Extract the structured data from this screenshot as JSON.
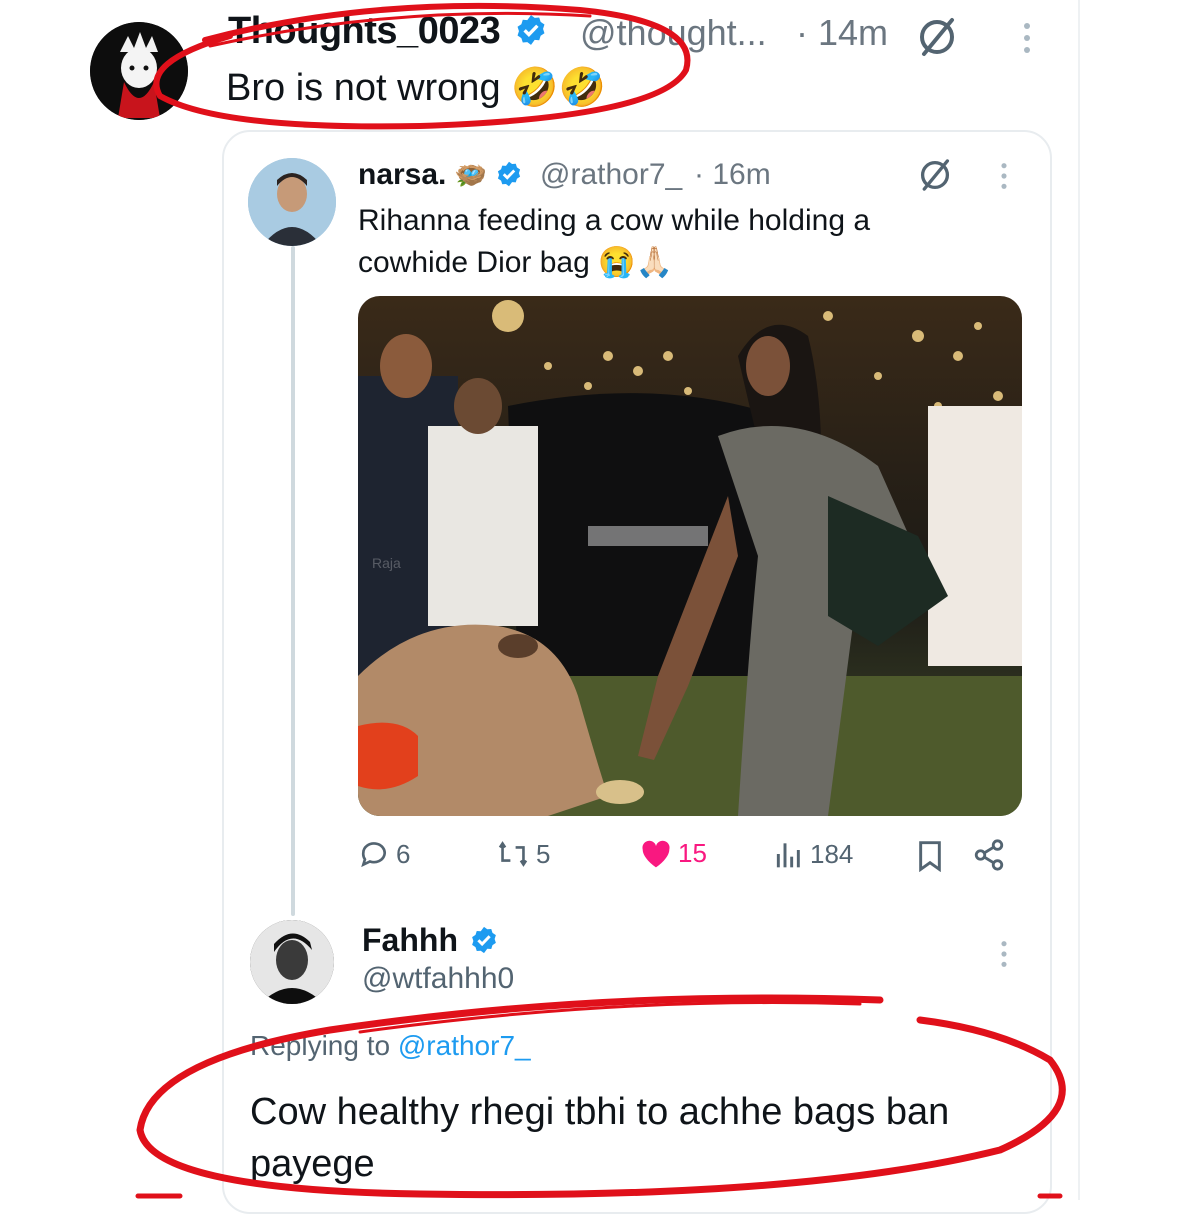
{
  "top_tweet": {
    "name": "Thoughts_0023",
    "handle": "@thought...",
    "time": "· 14m",
    "text": "Bro is not wrong 🤣🤣"
  },
  "quoted_tweet": {
    "name": "narsa.",
    "handle": "@rathor7_",
    "time": "· 16m",
    "text": "Rihanna feeding a cow while holding a cowhide Dior bag 😭🙏🏻",
    "photo_watermark": "Raja",
    "actions": {
      "replies": "6",
      "reposts": "5",
      "likes": "15",
      "views": "184"
    }
  },
  "reply": {
    "name": "Fahhh",
    "handle": "@wtfahhh0",
    "replying_prefix": "Replying to",
    "replying_to": "@rathor7_",
    "text": "Cow healthy rhegi tbhi to achhe bags ban payege"
  },
  "colors": {
    "verified": "#1d9bf0",
    "like": "#f91880",
    "annotation": "#e0101a"
  },
  "icons": [
    "verified-badge-icon",
    "grok-icon",
    "more-icon",
    "reply-icon",
    "repost-icon",
    "heart-icon",
    "views-icon",
    "bookmark-icon",
    "share-icon"
  ]
}
